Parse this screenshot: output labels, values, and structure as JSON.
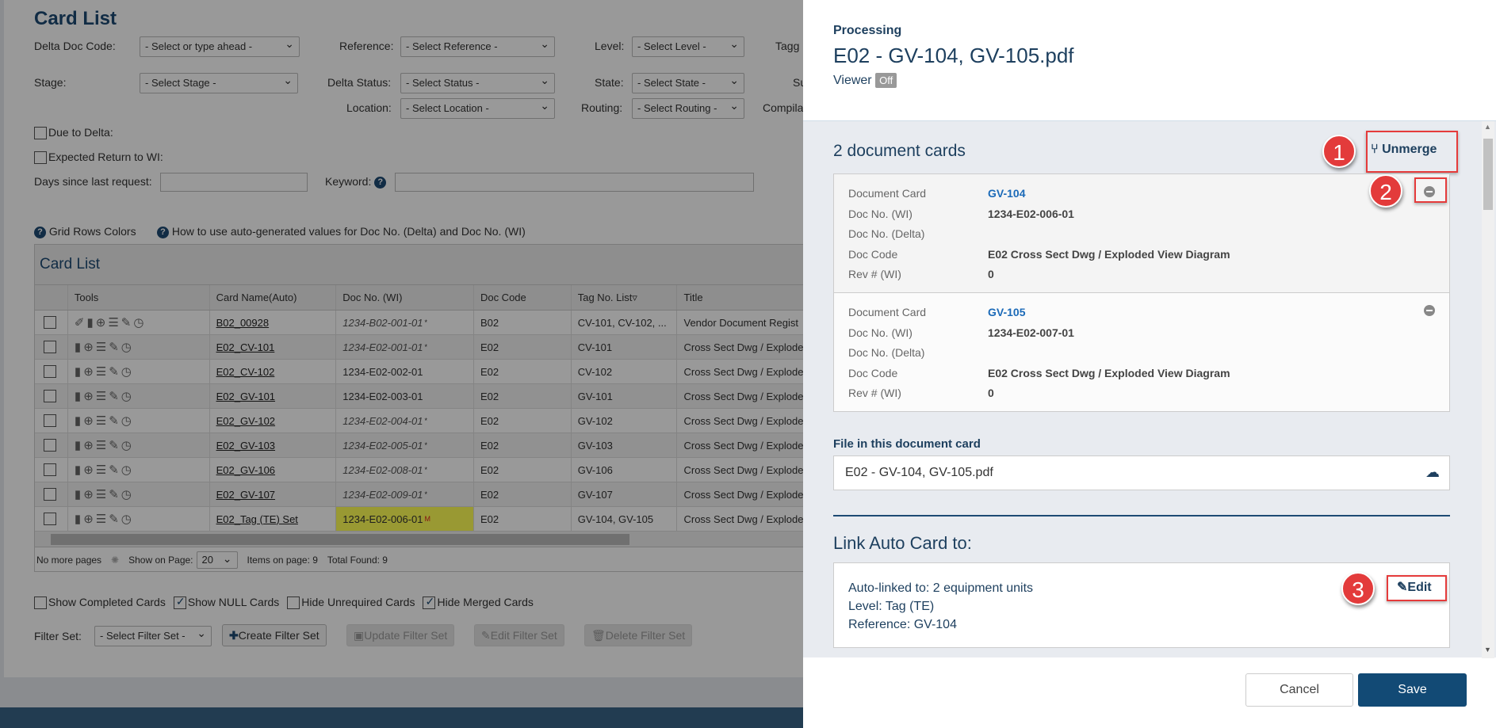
{
  "background": {
    "title": "Card List",
    "filters": {
      "delta_doc_code": {
        "label": "Delta Doc Code:",
        "value": "- Select or type ahead -"
      },
      "reference": {
        "label": "Reference:",
        "value": "- Select Reference -"
      },
      "level": {
        "label": "Level:",
        "value": "- Select Level -"
      },
      "tagged": {
        "label": "Tagg"
      },
      "stage": {
        "label": "Stage:",
        "value": "- Select Stage -"
      },
      "delta_status": {
        "label": "Delta Status:",
        "value": "- Select Status -"
      },
      "state": {
        "label": "State:",
        "value": "- Select State -"
      },
      "su": {
        "label": "Su"
      },
      "location": {
        "label": "Location:",
        "value": "- Select Location -"
      },
      "routing": {
        "label": "Routing:",
        "value": "- Select Routing -"
      },
      "compila": {
        "label": "Compila"
      },
      "due_to_delta": {
        "label": "Due to Delta:",
        "checked": false
      },
      "expected_return": {
        "label": "Expected Return to WI:",
        "checked": false
      },
      "days_since": {
        "label": "Days since last request:",
        "value": ""
      },
      "keyword": {
        "label": "Keyword:",
        "value": ""
      }
    },
    "help_links": [
      "Grid Rows Colors",
      "How to use auto-generated values for Doc No. (Delta) and Doc No. (WI)"
    ],
    "grid": {
      "title": "Card List",
      "columns": [
        "",
        "Tools",
        "Card Name(Auto)",
        "Doc No. (WI)",
        "Doc Code",
        "Tag No. List",
        "Title"
      ],
      "rows": [
        {
          "name": "B02_00928",
          "doc_no": "1234-B02-001-01",
          "italic": true,
          "mark": "*",
          "doc_code": "B02",
          "tags": "CV-101, CV-102, ...",
          "title": "Vendor Document Regist",
          "clip": true
        },
        {
          "name": "E02_CV-101",
          "doc_no": "1234-E02-001-01",
          "italic": true,
          "mark": "*",
          "doc_code": "E02",
          "tags": "CV-101",
          "title": "Cross Sect Dwg / Explode"
        },
        {
          "name": "E02_CV-102",
          "doc_no": "1234-E02-002-01",
          "italic": false,
          "mark": "",
          "doc_code": "E02",
          "tags": "CV-102",
          "title": "Cross Sect Dwg / Explode"
        },
        {
          "name": "E02_GV-101",
          "doc_no": "1234-E02-003-01",
          "italic": false,
          "mark": "",
          "doc_code": "E02",
          "tags": "GV-101",
          "title": "Cross Sect Dwg / Explode"
        },
        {
          "name": "E02_GV-102",
          "doc_no": "1234-E02-004-01",
          "italic": true,
          "mark": "*",
          "doc_code": "E02",
          "tags": "GV-102",
          "title": "Cross Sect Dwg / Explode"
        },
        {
          "name": "E02_GV-103",
          "doc_no": "1234-E02-005-01",
          "italic": true,
          "mark": "*",
          "doc_code": "E02",
          "tags": "GV-103",
          "title": "Cross Sect Dwg / Explode"
        },
        {
          "name": "E02_GV-106",
          "doc_no": "1234-E02-008-01",
          "italic": true,
          "mark": "*",
          "doc_code": "E02",
          "tags": "GV-106",
          "title": "Cross Sect Dwg / Explode"
        },
        {
          "name": "E02_GV-107",
          "doc_no": "1234-E02-009-01",
          "italic": true,
          "mark": "*",
          "doc_code": "E02",
          "tags": "GV-107",
          "title": "Cross Sect Dwg / Explode"
        },
        {
          "name": "E02_Tag (TE) Set",
          "doc_no": "1234-E02-006-01",
          "italic": false,
          "mark": "M",
          "highlight": true,
          "doc_code": "E02",
          "tags": "GV-104, GV-105",
          "title": "Cross Sect Dwg / Explode"
        }
      ],
      "pager": {
        "no_more": "No more pages",
        "show_on_page_label": "Show on Page:",
        "show_on_page": "20",
        "items_on_page": "Items on page: 9",
        "total_found": "Total Found: 9"
      }
    },
    "options": [
      {
        "label": "Show Completed Cards",
        "checked": false
      },
      {
        "label": "Show NULL Cards",
        "checked": true
      },
      {
        "label": "Hide Unrequired Cards",
        "checked": false
      },
      {
        "label": "Hide Merged Cards",
        "checked": true
      }
    ],
    "filter_set": {
      "label": "Filter Set:",
      "value": "- Select Filter Set -",
      "create": "Create Filter Set",
      "update": "Update Filter Set",
      "edit": "Edit Filter Set",
      "delete": "Delete Filter Set"
    }
  },
  "panel": {
    "subtitle": "Processing",
    "title": "E02 - GV-104, GV-105.pdf",
    "viewer_label": "Viewer",
    "viewer_state": "Off",
    "cards_heading": "2 document cards",
    "unmerge": "Unmerge",
    "cards": [
      {
        "fields": [
          [
            "Document Card",
            "GV-104"
          ],
          [
            "Doc No. (WI)",
            "1234-E02-006-01"
          ],
          [
            "Doc No. (Delta)",
            ""
          ],
          [
            "Doc Code",
            "E02 Cross Sect Dwg / Exploded View Diagram"
          ],
          [
            "Rev # (WI)",
            "0"
          ]
        ]
      },
      {
        "fields": [
          [
            "Document Card",
            "GV-105"
          ],
          [
            "Doc No. (WI)",
            "1234-E02-007-01"
          ],
          [
            "Doc No. (Delta)",
            ""
          ],
          [
            "Doc Code",
            "E02 Cross Sect Dwg / Exploded View Diagram"
          ],
          [
            "Rev # (WI)",
            "0"
          ]
        ]
      }
    ],
    "file_label": "File in this document card",
    "file_name": "E02 - GV-104, GV-105.pdf",
    "link_heading": "Link Auto Card to:",
    "link_lines": [
      "Auto-linked to: 2 equipment units",
      "Level: Tag (TE)",
      "Reference: GV-104"
    ],
    "edit": "Edit",
    "cancel": "Cancel",
    "save": "Save",
    "callouts": [
      "1",
      "2",
      "3"
    ]
  },
  "colors": {
    "accent": "#1d4a73",
    "save": "#124a75",
    "callout": "#e33b3b",
    "highlight": "#ffff55"
  }
}
